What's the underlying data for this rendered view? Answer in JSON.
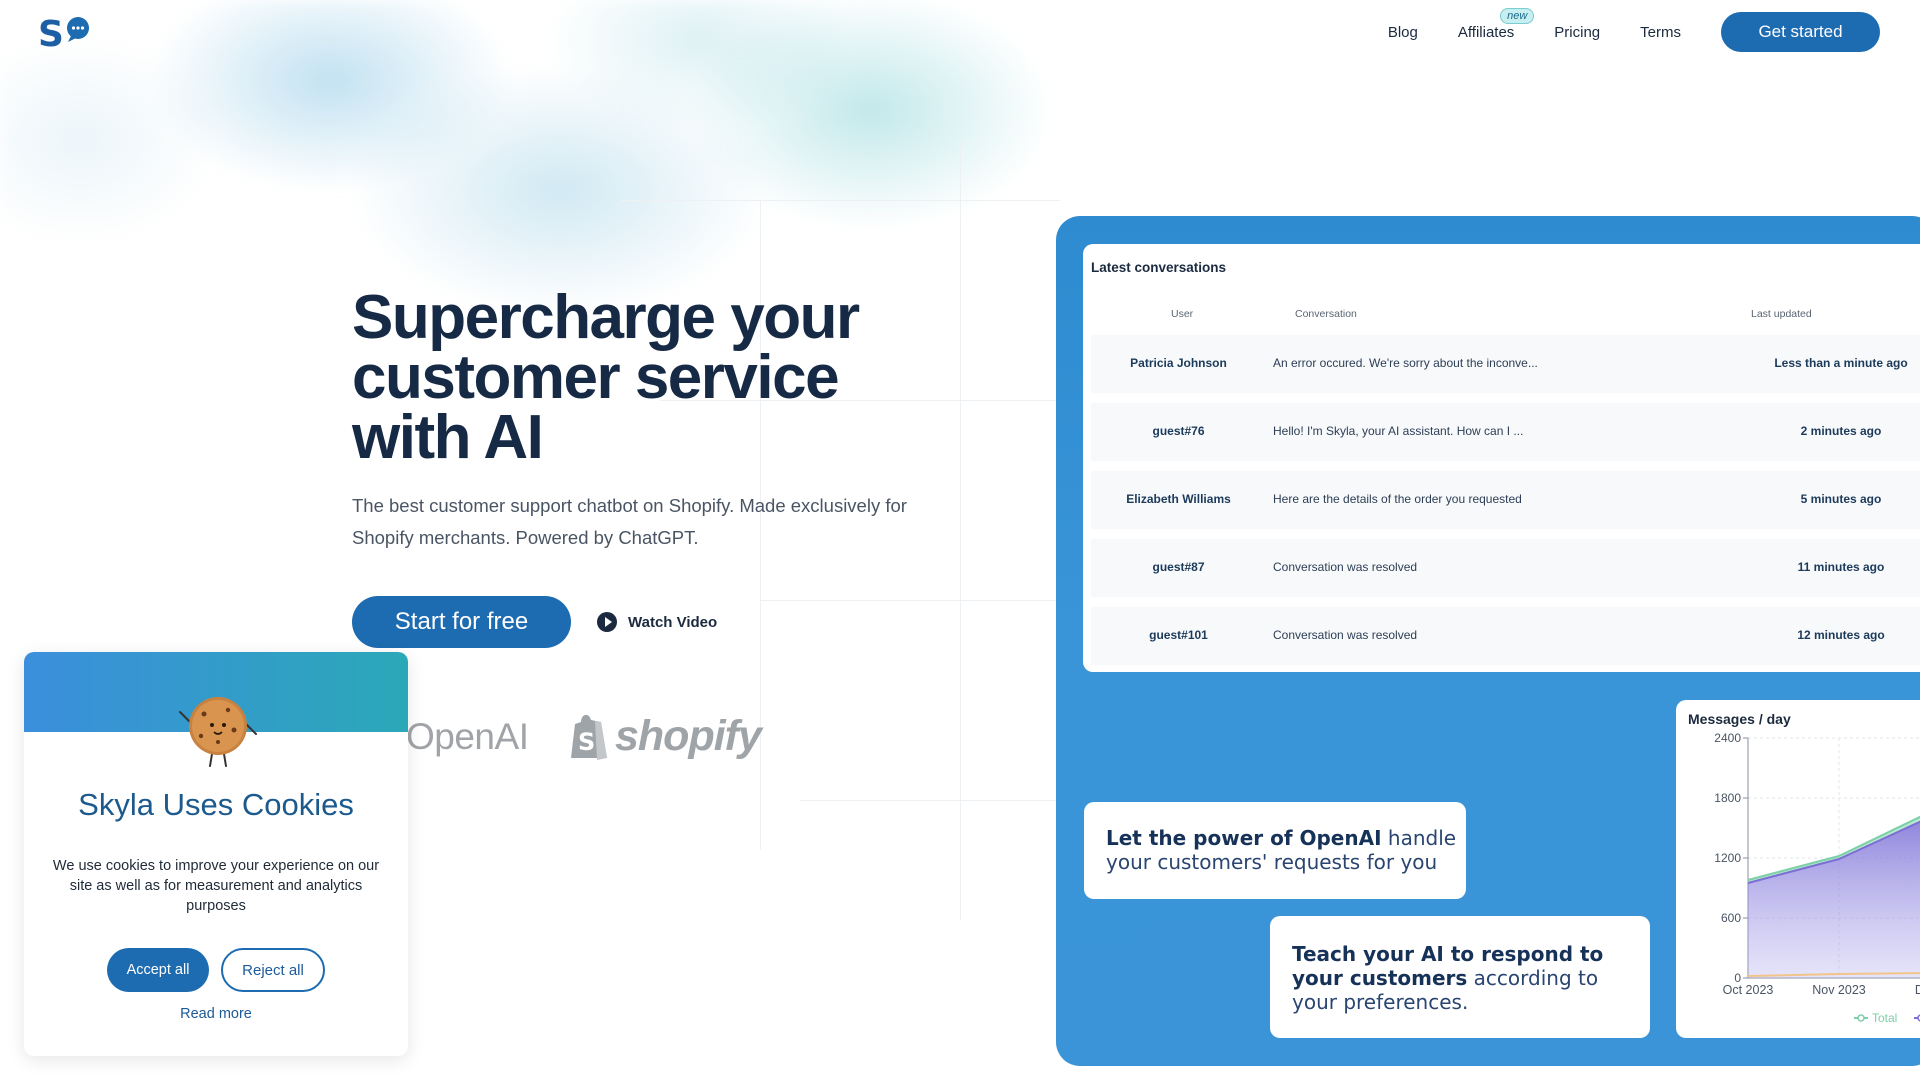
{
  "nav": {
    "links": [
      "Blog",
      "Affiliates",
      "Pricing",
      "Terms"
    ],
    "affiliates_badge": "new",
    "cta": "Get started"
  },
  "hero": {
    "title": "Supercharge your customer service with AI",
    "subtitle": "The best customer support chatbot on Shopify. Made exclusively for Shopify merchants. Powered by ChatGPT.",
    "primary_button": "Start for free",
    "secondary_button": "Watch Video",
    "partners": [
      "OpenAI",
      "shopify"
    ]
  },
  "conversations": {
    "title": "Latest conversations",
    "columns": [
      "User",
      "Conversation",
      "Last updated"
    ],
    "rows": [
      {
        "user": "Patricia Johnson",
        "conversation": "An error occured. We're sorry about the inconve...",
        "updated": "Less than a minute ago"
      },
      {
        "user": "guest#76",
        "conversation": "Hello! I'm Skyla, your AI assistant. How can I ...",
        "updated": "2 minutes ago"
      },
      {
        "user": "Elizabeth Williams",
        "conversation": "Here are the details of the order you requested",
        "updated": "5 minutes ago"
      },
      {
        "user": "guest#87",
        "conversation": "Conversation was resolved",
        "updated": "11 minutes ago"
      },
      {
        "user": "guest#101",
        "conversation": "Conversation was resolved",
        "updated": "12 minutes ago"
      }
    ]
  },
  "feature_cards": {
    "card1": {
      "strong": "Let the power of OpenAI",
      "rest": " handle your customers' requests for you"
    },
    "card2": {
      "strong": "Teach your AI to respond to your customers",
      "rest": " according to your preferences."
    }
  },
  "chart_data": {
    "type": "area",
    "title": "Messages / day",
    "xlabel": "",
    "ylabel": "",
    "ylim": [
      0,
      2400
    ],
    "yticks": [
      0,
      600,
      1200,
      1800,
      2400
    ],
    "x_tick_labels": [
      "Oct 2023",
      "Nov 2023",
      "Dec"
    ],
    "series": [
      {
        "name": "Total",
        "color": "#7ccfa8",
        "x": [
          "Oct 2023",
          "Nov 2023",
          "Dec"
        ],
        "values": [
          980,
          1220,
          1640
        ]
      },
      {
        "name": "",
        "color": "#7b6fd6",
        "x": [
          "Oct 2023",
          "Nov 2023",
          "Dec"
        ],
        "values": [
          950,
          1190,
          1590
        ]
      },
      {
        "name": "",
        "color": "#f2c48a",
        "x": [
          "Oct 2023",
          "Nov 2023",
          "Dec"
        ],
        "values": [
          20,
          40,
          50
        ]
      }
    ],
    "grid": true,
    "legend": "bottom"
  },
  "cookie": {
    "title": "Skyla Uses Cookies",
    "text": "We use cookies to improve your experience on our site as well as for measurement and analytics purposes",
    "accept": "Accept all",
    "reject": "Reject all",
    "read_more": "Read more"
  },
  "colors": {
    "brand": "#1d6bb0",
    "panel": "#3591d6",
    "heading": "#172a45"
  }
}
